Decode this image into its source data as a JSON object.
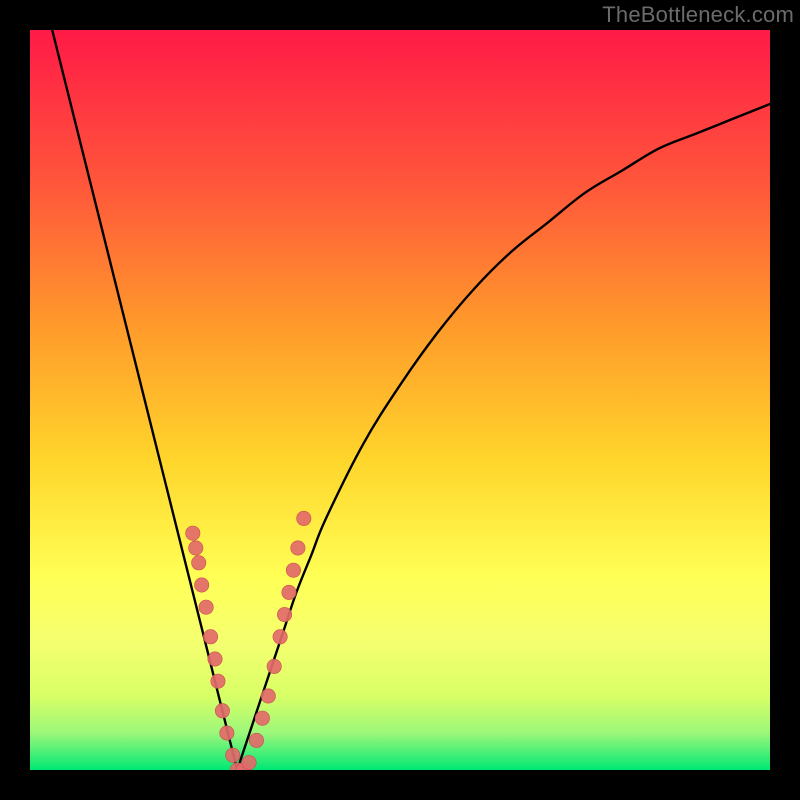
{
  "watermark": "TheBottleneck.com",
  "colors": {
    "frame": "#000000",
    "gradient_top": "#ff1a47",
    "gradient_mid1": "#ff7a2b",
    "gradient_mid2": "#ffd52b",
    "gradient_mid3": "#ffff66",
    "gradient_mid4": "#d8ff66",
    "gradient_bottom": "#00e874",
    "curve": "#000000",
    "marker_fill": "#e26a6a",
    "marker_stroke": "#c94f4f"
  },
  "chart_data": {
    "type": "line",
    "title": "",
    "xlabel": "",
    "ylabel": "",
    "xlim": [
      0,
      100
    ],
    "ylim": [
      0,
      100
    ],
    "notes": "Bottleneck-style V curve. x is a normalized component ratio (0–100). y is bottleneck percentage (0 at the minimum, rising toward 100 away from it). Gradient background: red (high bottleneck) at top through orange/yellow to green (no bottleneck) at bottom. Left branch descends steeply from top-left to the minimum near x≈28; right branch rises with diminishing slope toward top-right. Salmon markers cluster on both branches near the bottom of the V.",
    "series": [
      {
        "name": "left-branch",
        "x": [
          3,
          5,
          7,
          9,
          11,
          13,
          15,
          17,
          19,
          21,
          22,
          23,
          24,
          25,
          26,
          27,
          28
        ],
        "values": [
          100,
          92,
          84,
          76,
          68,
          60,
          52,
          44,
          36,
          28,
          24,
          20,
          16,
          12,
          8,
          4,
          0
        ]
      },
      {
        "name": "right-branch",
        "x": [
          28,
          30,
          32,
          34,
          36,
          38,
          40,
          45,
          50,
          55,
          60,
          65,
          70,
          75,
          80,
          85,
          90,
          95,
          100
        ],
        "values": [
          0,
          6,
          12,
          18,
          24,
          29,
          34,
          44,
          52,
          59,
          65,
          70,
          74,
          78,
          81,
          84,
          86,
          88,
          90
        ]
      }
    ],
    "markers": [
      {
        "x": 22.0,
        "y": 32
      },
      {
        "x": 22.4,
        "y": 30
      },
      {
        "x": 22.8,
        "y": 28
      },
      {
        "x": 23.2,
        "y": 25
      },
      {
        "x": 23.8,
        "y": 22
      },
      {
        "x": 24.4,
        "y": 18
      },
      {
        "x": 25.0,
        "y": 15
      },
      {
        "x": 25.4,
        "y": 12
      },
      {
        "x": 26.0,
        "y": 8
      },
      {
        "x": 26.6,
        "y": 5
      },
      {
        "x": 27.4,
        "y": 2
      },
      {
        "x": 28.0,
        "y": 0
      },
      {
        "x": 28.8,
        "y": 0
      },
      {
        "x": 29.6,
        "y": 1
      },
      {
        "x": 30.6,
        "y": 4
      },
      {
        "x": 31.4,
        "y": 7
      },
      {
        "x": 32.2,
        "y": 10
      },
      {
        "x": 33.0,
        "y": 14
      },
      {
        "x": 33.8,
        "y": 18
      },
      {
        "x": 34.4,
        "y": 21
      },
      {
        "x": 35.0,
        "y": 24
      },
      {
        "x": 35.6,
        "y": 27
      },
      {
        "x": 36.2,
        "y": 30
      },
      {
        "x": 37.0,
        "y": 34
      }
    ]
  }
}
